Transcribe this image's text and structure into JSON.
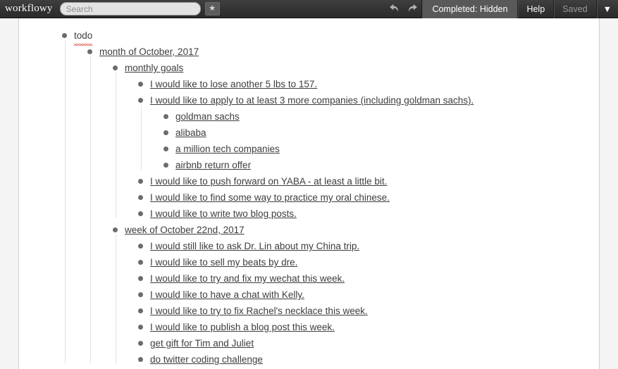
{
  "header": {
    "brand": "workflowy",
    "search": {
      "placeholder": "Search",
      "value": ""
    },
    "star_label": "★",
    "undo_label": "undo-arrow",
    "redo_label": "redo-arrow",
    "completed_label": "Completed: Hidden",
    "help_label": "Help",
    "saved_label": "Saved",
    "caret_label": "▼"
  },
  "colors": {
    "header_bg": "#343434",
    "completed_btn_bg": "#595959",
    "rail_bg": "#f4f4f4",
    "rail_border": "#cfcfcf",
    "text": "#3d3d3d",
    "bullet": "#6b6b6b",
    "guide_line": "#e2e2e2",
    "spellcheck": "#e04a3a",
    "muted_text": "#9a9a9a"
  },
  "outline": {
    "root_label": "todo",
    "root_editing": true,
    "month_label": "month of October, 2017",
    "monthly_goals_label": "monthly goals",
    "monthly_goals_items": [
      "I would like to lose another 5 lbs to 157.",
      "I would like to apply to at least 3 more companies (including goldman sachs)."
    ],
    "companies": [
      "goldman sachs",
      "alibaba",
      "a million tech companies",
      "airbnb return offer"
    ],
    "monthly_goals_items_rest": [
      "I would like to push forward on YABA - at least a little bit.",
      "I would like to find some way to practice my oral chinese.",
      "I would like to write two blog posts."
    ],
    "week_label": "week of October 22nd, 2017",
    "week_items": [
      "I would still like to ask Dr. Lin about my China trip.",
      "I would like to sell my beats by dre.",
      "I would like to try and fix my wechat this week.",
      "I would like to have a chat with Kelly.",
      "I would like to try to fix Rachel's necklace this week.",
      "I would like to publish a blog post this week.",
      "get gift for Tim and Juliet",
      "do twitter coding challenge"
    ]
  }
}
